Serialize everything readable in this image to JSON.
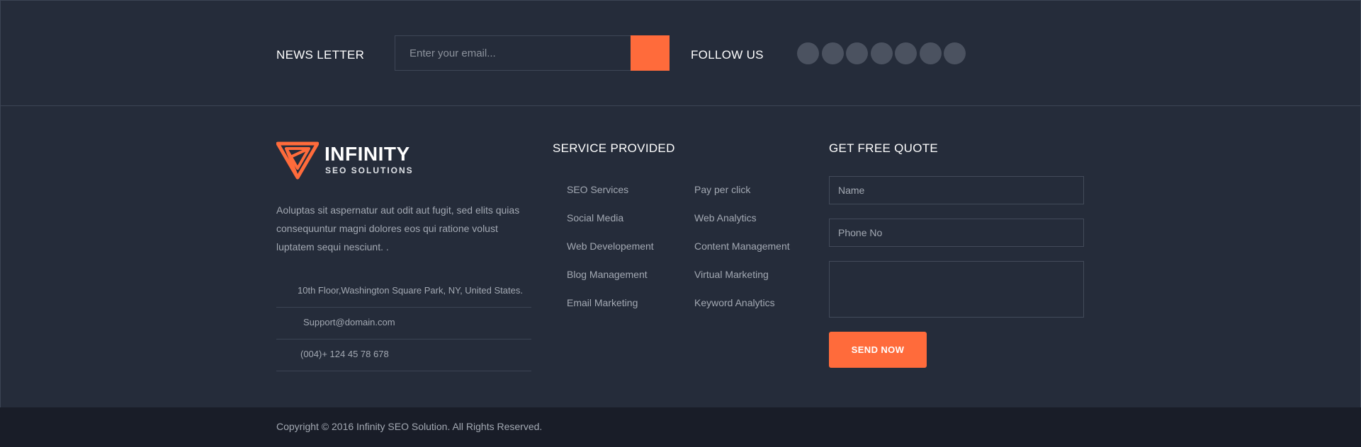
{
  "newsletter": {
    "title": "NEWS LETTER",
    "email_placeholder": "Enter your email...",
    "submit_icon": "paper-plane-icon"
  },
  "follow": {
    "title": "FOLLOW US",
    "social_icons": [
      "facebook-icon",
      "twitter-icon",
      "google-plus-icon",
      "linkedin-icon",
      "pinterest-icon",
      "instagram-icon",
      "youtube-icon"
    ]
  },
  "brand": {
    "name": "INFINITY",
    "tagline": "SEO SOLUTIONS",
    "about": "Aoluptas sit aspernatur aut odit aut fugit, sed elits quias consequuntur magni dolores eos qui ratione volust luptatem sequi nesciunt. .",
    "accent_color": "#ff6b3b"
  },
  "contact": {
    "address": "10th Floor,Washington Square Park, NY, United States.",
    "email": "Support@domain.com",
    "phone": "(004)+ 124 45 78 678"
  },
  "services": {
    "title": "SERVICE PROVIDED",
    "col1": [
      "SEO Services",
      "Social Media",
      "Web Developement",
      "Blog Management",
      "Email Marketing"
    ],
    "col2": [
      "Pay per click",
      "Web Analytics",
      "Content Management",
      "Virtual Marketing",
      "Keyword Analytics"
    ]
  },
  "quote": {
    "title": "GET FREE QUOTE",
    "name_placeholder": "Name",
    "phone_placeholder": "Phone No",
    "message_placeholder": "",
    "button_label": "SEND NOW"
  },
  "footer": {
    "copyright": "Copyright © 2016 Infinity SEO Solution. All Rights Reserved."
  }
}
